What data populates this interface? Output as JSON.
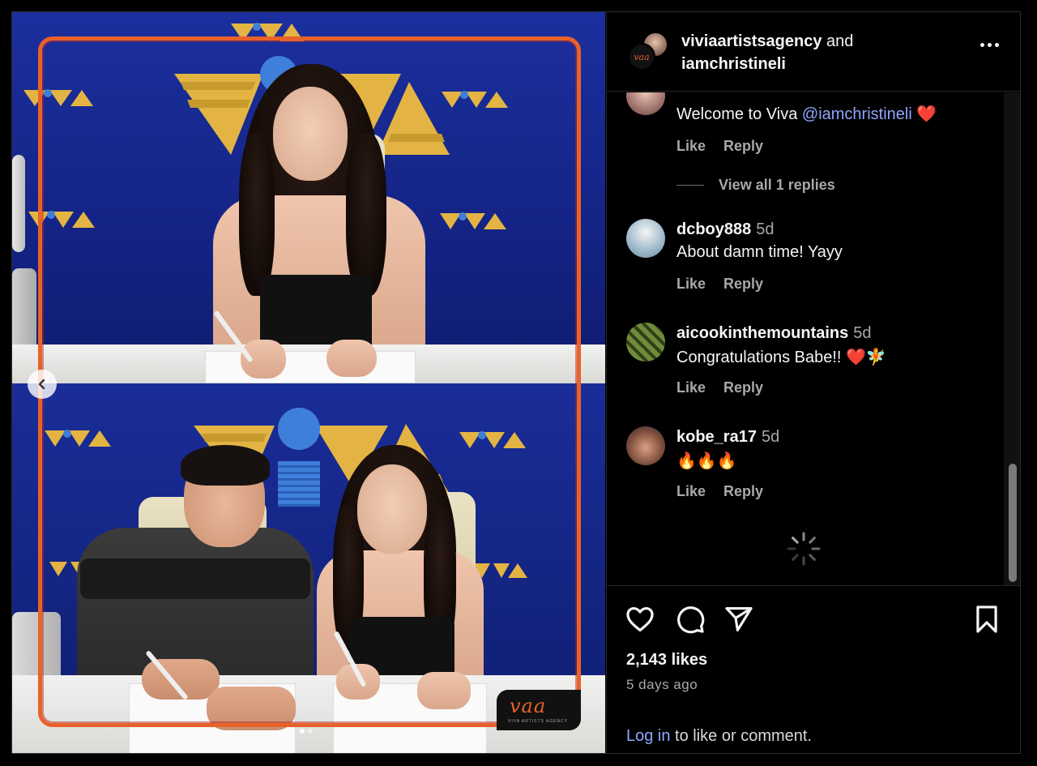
{
  "post": {
    "owner_primary": "viviaartistsagency",
    "owner_joiner": "and",
    "owner_secondary": "iamchristineli",
    "avatar_logo_text": "vaa",
    "media_badge_text": "vaa",
    "media_badge_sub": "VIVA ARTISTS AGENCY"
  },
  "comments": [
    {
      "username": "",
      "time": "",
      "text_before": "Welcome to Viva ",
      "mention": "@iamchristineli",
      "text_after": " ❤️",
      "like_label": "Like",
      "reply_label": "Reply",
      "view_replies": "View all 1 replies"
    },
    {
      "username": "dcboy888",
      "time": "5d",
      "text": "About damn time! Yayy",
      "like_label": "Like",
      "reply_label": "Reply"
    },
    {
      "username": "aicookinthemountains",
      "time": "5d",
      "text": "Congratulations Babe!! ❤️🧚",
      "like_label": "Like",
      "reply_label": "Reply"
    },
    {
      "username": "kobe_ra17",
      "time": "5d",
      "text": "🔥🔥🔥",
      "like_label": "Like",
      "reply_label": "Reply"
    }
  ],
  "footer": {
    "likes": "2,143 likes",
    "posted_ago": "5 days ago",
    "login_link": "Log in",
    "login_rest": " to like or comment."
  },
  "icons": {
    "like": "heart-icon",
    "comment": "comment-bubble-icon",
    "share": "paper-plane-icon",
    "save": "bookmark-icon",
    "more": "more-options-icon",
    "prev": "chevron-left-icon",
    "loading": "loading-spinner-icon"
  },
  "colors": {
    "accent_link": "#8fa6ff",
    "frame_orange": "#e8622a",
    "wall_blue": "#1b2f9e",
    "logo_gold": "#e3b443"
  }
}
